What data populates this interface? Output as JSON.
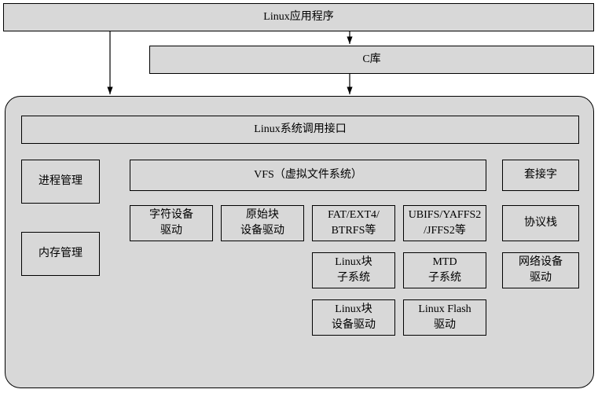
{
  "top": {
    "app": "Linux应用程序",
    "clib": "C库"
  },
  "kernel": {
    "syscall": "Linux系统调用接口",
    "left": {
      "proc": "进程管理",
      "mem": "内存管理"
    },
    "vfs": "VFS（虚拟文件系统）",
    "right": {
      "socket": "套接字",
      "proto": "协议栈",
      "netdev": "网络设备\n驱动"
    },
    "row1": {
      "chardev": "字符设备\n驱动",
      "rawblock": "原始块\n设备驱动",
      "fs": "FAT/EXT4/\nBTRFS等",
      "flashfs": "UBIFS/YAFFS2\n/JFFS2等"
    },
    "row2": {
      "blksub": "Linux块\n子系统",
      "mtdsub": "MTD\n子系统"
    },
    "row3": {
      "blkdev": "Linux块\n设备驱动",
      "flashdev": "Linux Flash\n驱动"
    }
  }
}
